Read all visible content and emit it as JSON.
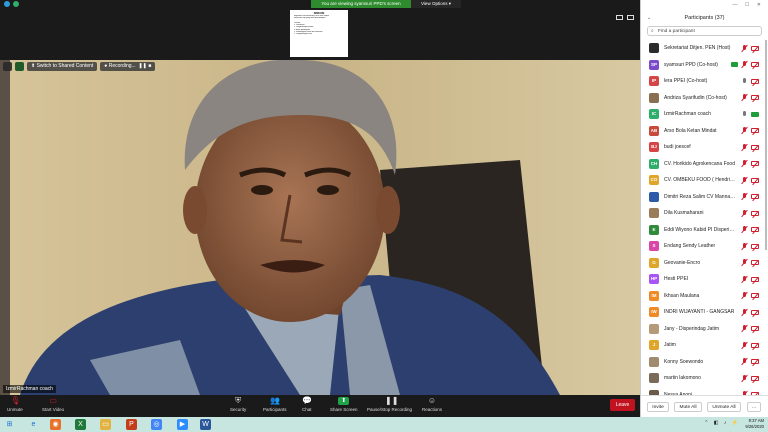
{
  "banner": {
    "sharing_text": "You are viewing syamsuri PPD's screen",
    "view_options": "View Options"
  },
  "shared_doc": {
    "title": "DISKUSI",
    "lines": [
      "Bagaimana kita mendorong UKM untuk ekspor",
      "dan produk apa yang akan dikembangkan",
      "",
      "Prioritas",
      "1. Pemasaran",
      "2. Pengembangan produk",
      "3. Akses pembiayaan",
      "4. Kelembagaan usaha dan kemitraan",
      "5. Pengembangan SDM"
    ]
  },
  "video_overlay": {
    "switch_label": "Switch to Shared Content",
    "recording_label": "Recording...",
    "name_label": "IzmirRachman coach"
  },
  "toolbar": {
    "unmute": "Unmute",
    "start_video": "Start Video",
    "security": "Security",
    "participants": "Participants",
    "participants_count": "37",
    "chat": "Chat",
    "share_screen": "Share Screen",
    "pause_recording": "Pause/Stop Recording",
    "reactions": "Reactions",
    "leave": "Leave"
  },
  "panel": {
    "title": "Participants (37)",
    "search_placeholder": "Find a participant",
    "participants": [
      {
        "initials": "",
        "name": "Sekretariat Ditjen. PEN (Host)",
        "color": "#2b2b2b",
        "mic": "off",
        "cam": "off",
        "share": false
      },
      {
        "initials": "SP",
        "name": "syamsuri PPD (Co-host)",
        "color": "#7b4bc9",
        "mic": "off",
        "cam": "off",
        "share": true
      },
      {
        "initials": "IP",
        "name": "lera PPEI (Co-host)",
        "color": "#d64545",
        "mic": "on",
        "cam": "off",
        "share": false
      },
      {
        "initials": "",
        "name": "Andriza Syarifudin (Co-host)",
        "color": "#8a6e52",
        "mic": "off",
        "cam": "off",
        "share": false
      },
      {
        "initials": "IC",
        "name": "IzmirRachman coach",
        "color": "#2fae6b",
        "mic": "on",
        "cam": "on",
        "share": false
      },
      {
        "initials": "AB",
        "name": "Arso Bola Ketan Mindat",
        "color": "#c74a3a",
        "mic": "off",
        "cam": "off",
        "share": false
      },
      {
        "initials": "BJ",
        "name": "budi joescef",
        "color": "#d64545",
        "mic": "off",
        "cam": "off",
        "share": false
      },
      {
        "initials": "CH",
        "name": "CV. Horikido Agrokencana Food",
        "color": "#2fae6b",
        "mic": "off",
        "cam": "off",
        "share": false
      },
      {
        "initials": "CO",
        "name": "CV. OMBEKU FOOD ( Hendri Ca...",
        "color": "#e0a62a",
        "mic": "off",
        "cam": "off",
        "share": false
      },
      {
        "initials": "",
        "name": "Dimitri Reza Salim CV Manna In...",
        "color": "#2a5aa8",
        "mic": "off",
        "cam": "off",
        "share": false
      },
      {
        "initials": "",
        "name": "Dila Kusmaharani",
        "color": "#9a7b5a",
        "mic": "off",
        "cam": "off",
        "share": false
      },
      {
        "initials": "E",
        "name": "Eddi Wiyono Kabid PI Disperind...",
        "color": "#2f8a3a",
        "mic": "off",
        "cam": "off",
        "share": false
      },
      {
        "initials": "S",
        "name": "Endang Sendy Leather",
        "color": "#d946a8",
        "mic": "off",
        "cam": "off",
        "share": false
      },
      {
        "initials": "G",
        "name": "Geovanie-Encro",
        "color": "#e0a62a",
        "mic": "off",
        "cam": "off",
        "share": false
      },
      {
        "initials": "HP",
        "name": "Hesti PPEI",
        "color": "#a855f7",
        "mic": "off",
        "cam": "off",
        "share": false
      },
      {
        "initials": "IM",
        "name": "Ikhsan Maulana",
        "color": "#f08a24",
        "mic": "off",
        "cam": "off",
        "share": false
      },
      {
        "initials": "IW",
        "name": "INDRI WIJAYANTI - GANGSAR",
        "color": "#f08a24",
        "mic": "off",
        "cam": "off",
        "share": false
      },
      {
        "initials": "",
        "name": "Jany - Disperindag Jatim",
        "color": "#b59a7a",
        "mic": "off",
        "cam": "off",
        "share": false
      },
      {
        "initials": "J",
        "name": "Jatim",
        "color": "#e0a62a",
        "mic": "off",
        "cam": "off",
        "share": false
      },
      {
        "initials": "",
        "name": "Konny Soewondo",
        "color": "#a08a70",
        "mic": "off",
        "cam": "off",
        "share": false
      },
      {
        "initials": "",
        "name": "martin lakomono",
        "color": "#7a6a5a",
        "mic": "off",
        "cam": "off",
        "share": false
      },
      {
        "initials": "",
        "name": "Nesya Anoni",
        "color": "#6b5a4a",
        "mic": "off",
        "cam": "off",
        "share": false
      }
    ],
    "footer": {
      "invite": "Invite",
      "mute_all": "Mute All",
      "unmute_all": "Unmute All"
    }
  },
  "taskbar": {
    "time": "9:37 AM",
    "date": "9/26/2020"
  }
}
